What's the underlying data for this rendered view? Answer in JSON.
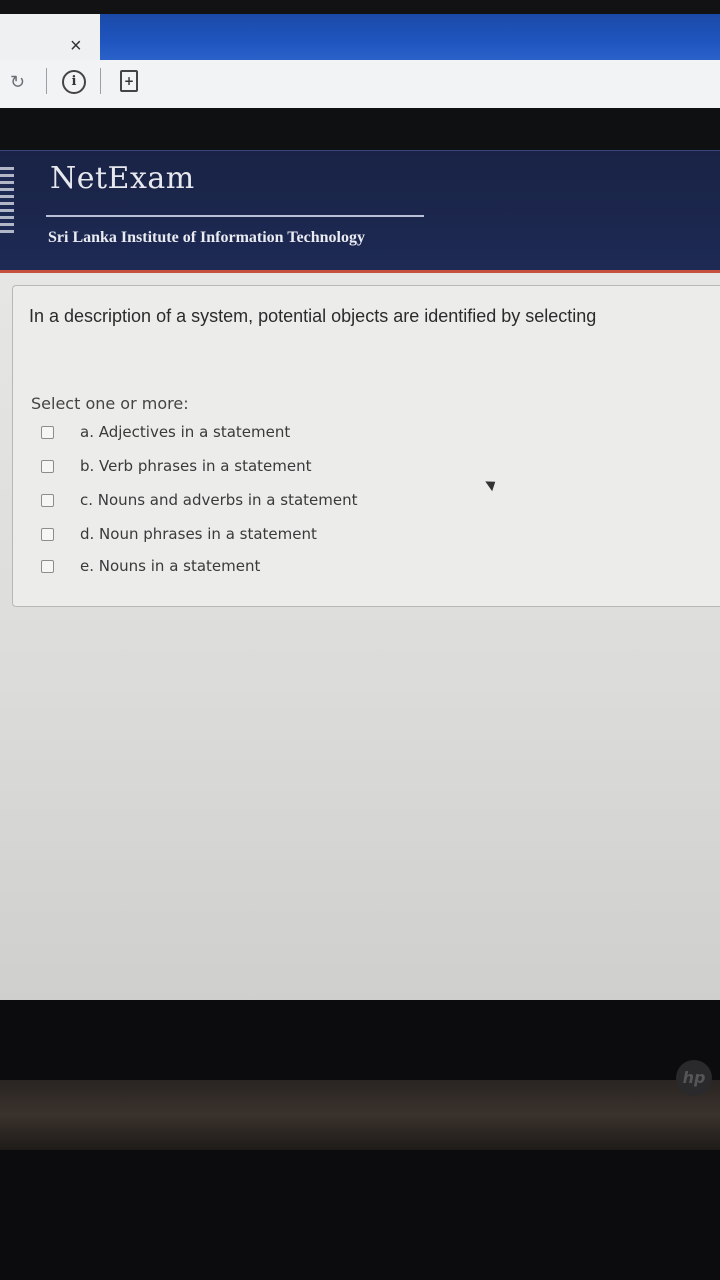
{
  "browser": {
    "tab_close": "×",
    "reload_icon": "reload-icon",
    "info_icon_glyph": "i",
    "doc_icon_glyph": "+"
  },
  "header": {
    "brand": "NetExam",
    "institute": "Sri Lanka Institute of Information Technology",
    "accent_color": "#c7503d",
    "bg_color": "#1d2a55"
  },
  "question": {
    "text": "In a description of a system,  potential objects are identified by selecting",
    "prompt": "Select one or more:",
    "options": [
      {
        "label": "a. Adjectives in a statement",
        "checked": false
      },
      {
        "label": "b. Verb phrases in a statement",
        "checked": false
      },
      {
        "label": "c. Nouns and adverbs in a statement",
        "checked": false
      },
      {
        "label": "d. Noun phrases in a statement",
        "checked": false
      },
      {
        "label": "e. Nouns in a statement",
        "checked": false
      }
    ]
  },
  "device": {
    "logo": "hp"
  }
}
